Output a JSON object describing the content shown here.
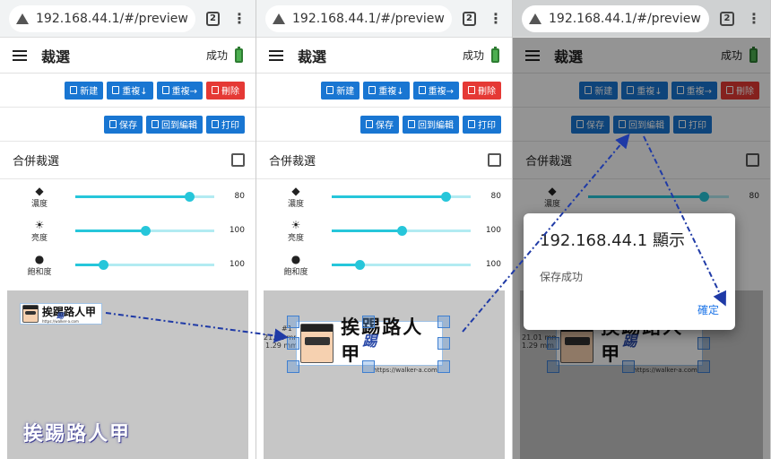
{
  "browser": {
    "url": "192.168.44.1/#/preview",
    "tab_count": "2"
  },
  "app": {
    "title": "裁選",
    "status": "成功"
  },
  "toolbar1": {
    "new": "新建",
    "dup_down": "重複↓",
    "dup_right": "重複→",
    "delete": "刪除"
  },
  "toolbar2": {
    "save": "保存",
    "back_edit": "回到編輯",
    "print": "打印"
  },
  "merge": {
    "label": "合併裁選"
  },
  "sliders": [
    {
      "label": "濃度",
      "value": "80",
      "level": 0.82
    },
    {
      "label": "亮度",
      "value": "100",
      "level": 0.5
    },
    {
      "label": "飽和度",
      "value": "100",
      "level": 0.2
    }
  ],
  "label": {
    "name": "挨踢路人甲",
    "stamp": "踢",
    "url": "https://walker-a.com",
    "dim1": "#1",
    "dim2": "21.01 mm",
    "dim3": "1.29 mm"
  },
  "watermark": "挨踢路人甲",
  "dialog": {
    "title": "192.168.44.1 顯示",
    "message": "保存成功",
    "ok": "確定"
  },
  "colors": {
    "primary": "#1976d2",
    "danger": "#e53935",
    "slider": "#26c6da",
    "battery": "#4caf50",
    "link": "#1a73e8"
  }
}
